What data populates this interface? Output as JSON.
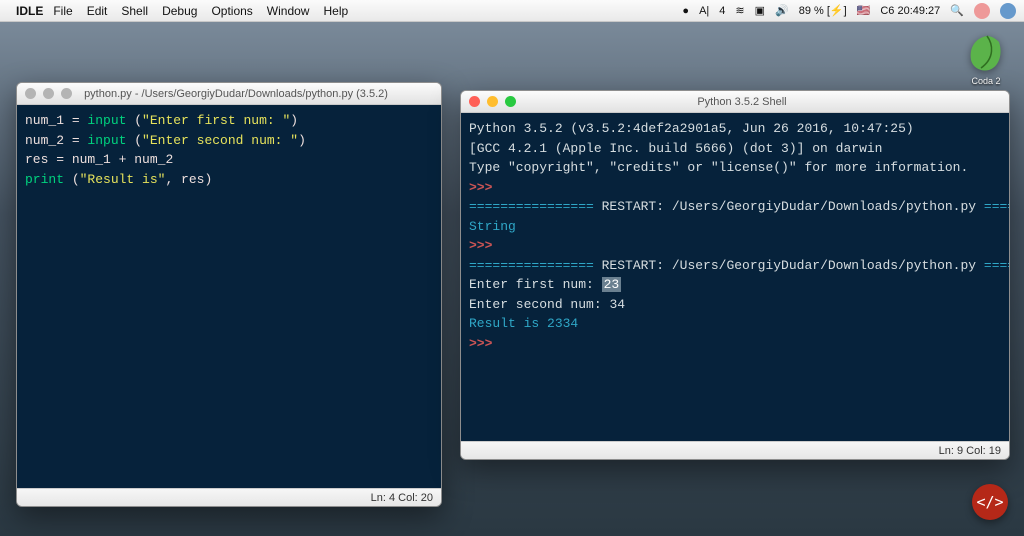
{
  "menubar": {
    "apple": "",
    "app": "IDLE",
    "items": [
      "File",
      "Edit",
      "Shell",
      "Debug",
      "Options",
      "Window",
      "Help"
    ],
    "right": {
      "mic": "●",
      "adobe": "A|",
      "notif": "4",
      "wifi": "≋",
      "screen": "▣",
      "vol": "🔊",
      "battery": "89 % [⚡]",
      "flag": "🇺🇸",
      "clock": "С6 20:49:27",
      "search": "🔍"
    }
  },
  "leaf": {
    "label": "Coda 2"
  },
  "editor": {
    "title": "python.py - /Users/GeorgiyDudar/Downloads/python.py (3.5.2)",
    "lines": [
      [
        {
          "t": "num_1",
          "c": "tok-var"
        },
        {
          "t": " = ",
          "c": "tok-op"
        },
        {
          "t": "input",
          "c": "tok-builtin"
        },
        {
          "t": " (",
          "c": "tok-paren"
        },
        {
          "t": "\"Enter first num: \"",
          "c": "tok-str"
        },
        {
          "t": ")",
          "c": "tok-paren"
        }
      ],
      [
        {
          "t": "num_2",
          "c": "tok-var"
        },
        {
          "t": " = ",
          "c": "tok-op"
        },
        {
          "t": "input",
          "c": "tok-builtin"
        },
        {
          "t": " (",
          "c": "tok-paren"
        },
        {
          "t": "\"Enter second num: \"",
          "c": "tok-str"
        },
        {
          "t": ")",
          "c": "tok-paren"
        }
      ],
      [
        {
          "t": "res",
          "c": "tok-var"
        },
        {
          "t": " = ",
          "c": "tok-op"
        },
        {
          "t": "num_1",
          "c": "tok-var"
        },
        {
          "t": " + ",
          "c": "tok-op"
        },
        {
          "t": "num_2",
          "c": "tok-var"
        }
      ],
      [
        {
          "t": "print",
          "c": "tok-print"
        },
        {
          "t": " (",
          "c": "tok-paren"
        },
        {
          "t": "\"Result is\"",
          "c": "tok-str"
        },
        {
          "t": ", res)",
          "c": "tok-paren"
        }
      ]
    ],
    "status": "Ln: 4  Col: 20"
  },
  "shell": {
    "title": "Python 3.5.2 Shell",
    "lines": [
      [
        {
          "t": "Python 3.5.2 (v3.5.2:4def2a2901a5, Jun 26 2016, 10:47:25)",
          "c": "tok-white"
        }
      ],
      [
        {
          "t": "[GCC 4.2.1 (Apple Inc. build 5666) (dot 3)] on darwin",
          "c": "tok-white"
        }
      ],
      [
        {
          "t": "Type \"copyright\", \"credits\" or \"license()\" for more information.",
          "c": "tok-white"
        }
      ],
      [
        {
          "t": ">>>",
          "c": "tok-prompt"
        }
      ],
      [
        {
          "t": "================",
          "c": "tok-bar"
        },
        {
          "t": " RESTART: /Users/GeorgiyDudar/Downloads/python.py ",
          "c": "tok-white"
        },
        {
          "t": "================",
          "c": "tok-bar"
        }
      ],
      [
        {
          "t": "String",
          "c": "tok-teal"
        }
      ],
      [
        {
          "t": ">>>",
          "c": "tok-prompt"
        }
      ],
      [
        {
          "t": "================",
          "c": "tok-bar"
        },
        {
          "t": " RESTART: /Users/GeorgiyDudar/Downloads/python.py ",
          "c": "tok-white"
        },
        {
          "t": "================",
          "c": "tok-bar"
        }
      ],
      [
        {
          "t": "",
          "c": "tok-white"
        }
      ],
      [
        {
          "t": "Enter first num: ",
          "c": "tok-white"
        },
        {
          "t": "23",
          "c": "tok-sel"
        }
      ],
      [
        {
          "t": "Enter second num: ",
          "c": "tok-white"
        },
        {
          "t": "34",
          "c": "tok-white"
        }
      ],
      [
        {
          "t": "Result is 2334",
          "c": "tok-teal"
        }
      ],
      [
        {
          "t": ">>>",
          "c": "tok-prompt"
        }
      ]
    ],
    "status": "Ln: 9  Col: 19"
  },
  "brand": {
    "text": "</>"
  }
}
